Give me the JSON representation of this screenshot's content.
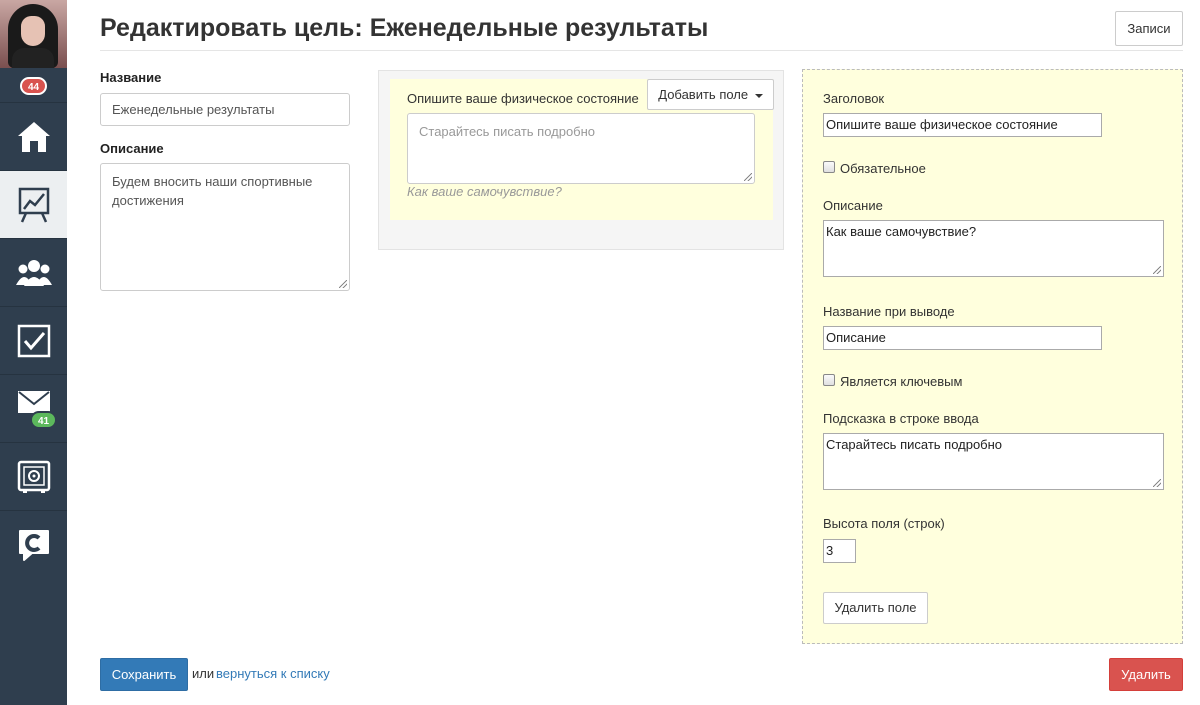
{
  "sidebar": {
    "notifications_count": "44",
    "items": [
      {
        "name": "home-icon"
      },
      {
        "name": "chart-board-icon",
        "active": true
      },
      {
        "name": "group-icon"
      },
      {
        "name": "checkbox-icon"
      },
      {
        "name": "mail-icon",
        "badge": "41"
      },
      {
        "name": "safe-icon"
      },
      {
        "name": "chat-c-icon"
      }
    ]
  },
  "header": {
    "title": "Редактировать цель: Еженедельные результаты",
    "records_button": "Записи"
  },
  "form": {
    "name_label": "Название",
    "name_value": "Еженедельные результаты",
    "description_label": "Описание",
    "description_value": "Будем вносить наши спортивные достижения"
  },
  "preview": {
    "field_label": "Опишите ваше физическое состояние",
    "add_field_button": "Добавить поле",
    "textarea_placeholder": "Старайтесь писать подробно",
    "hint": "Как ваше самочувствие?"
  },
  "field_settings": {
    "heading_label": "Заголовок",
    "heading_value": "Опишите ваше физическое состояние",
    "required_label": "Обязательное",
    "required_checked": false,
    "description_label": "Описание",
    "description_value": "Как ваше самочувствие?",
    "output_name_label": "Название при выводе",
    "output_name_value": "Описание",
    "is_key_label": "Является ключевым",
    "is_key_checked": false,
    "placeholder_label": "Подсказка в строке ввода",
    "placeholder_value": "Старайтесь писать подробно",
    "rows_label": "Высота поля (строк)",
    "rows_value": "3",
    "delete_field_button": "Удалить поле"
  },
  "footer": {
    "save_button": "Сохранить",
    "or_text": "или",
    "back_link": "вернуться к списку",
    "delete_button": "Удалить"
  },
  "colors": {
    "sidebar": "#2f3e4e",
    "primary": "#337ab7",
    "danger": "#d9534f",
    "highlight": "#ffffdd"
  }
}
